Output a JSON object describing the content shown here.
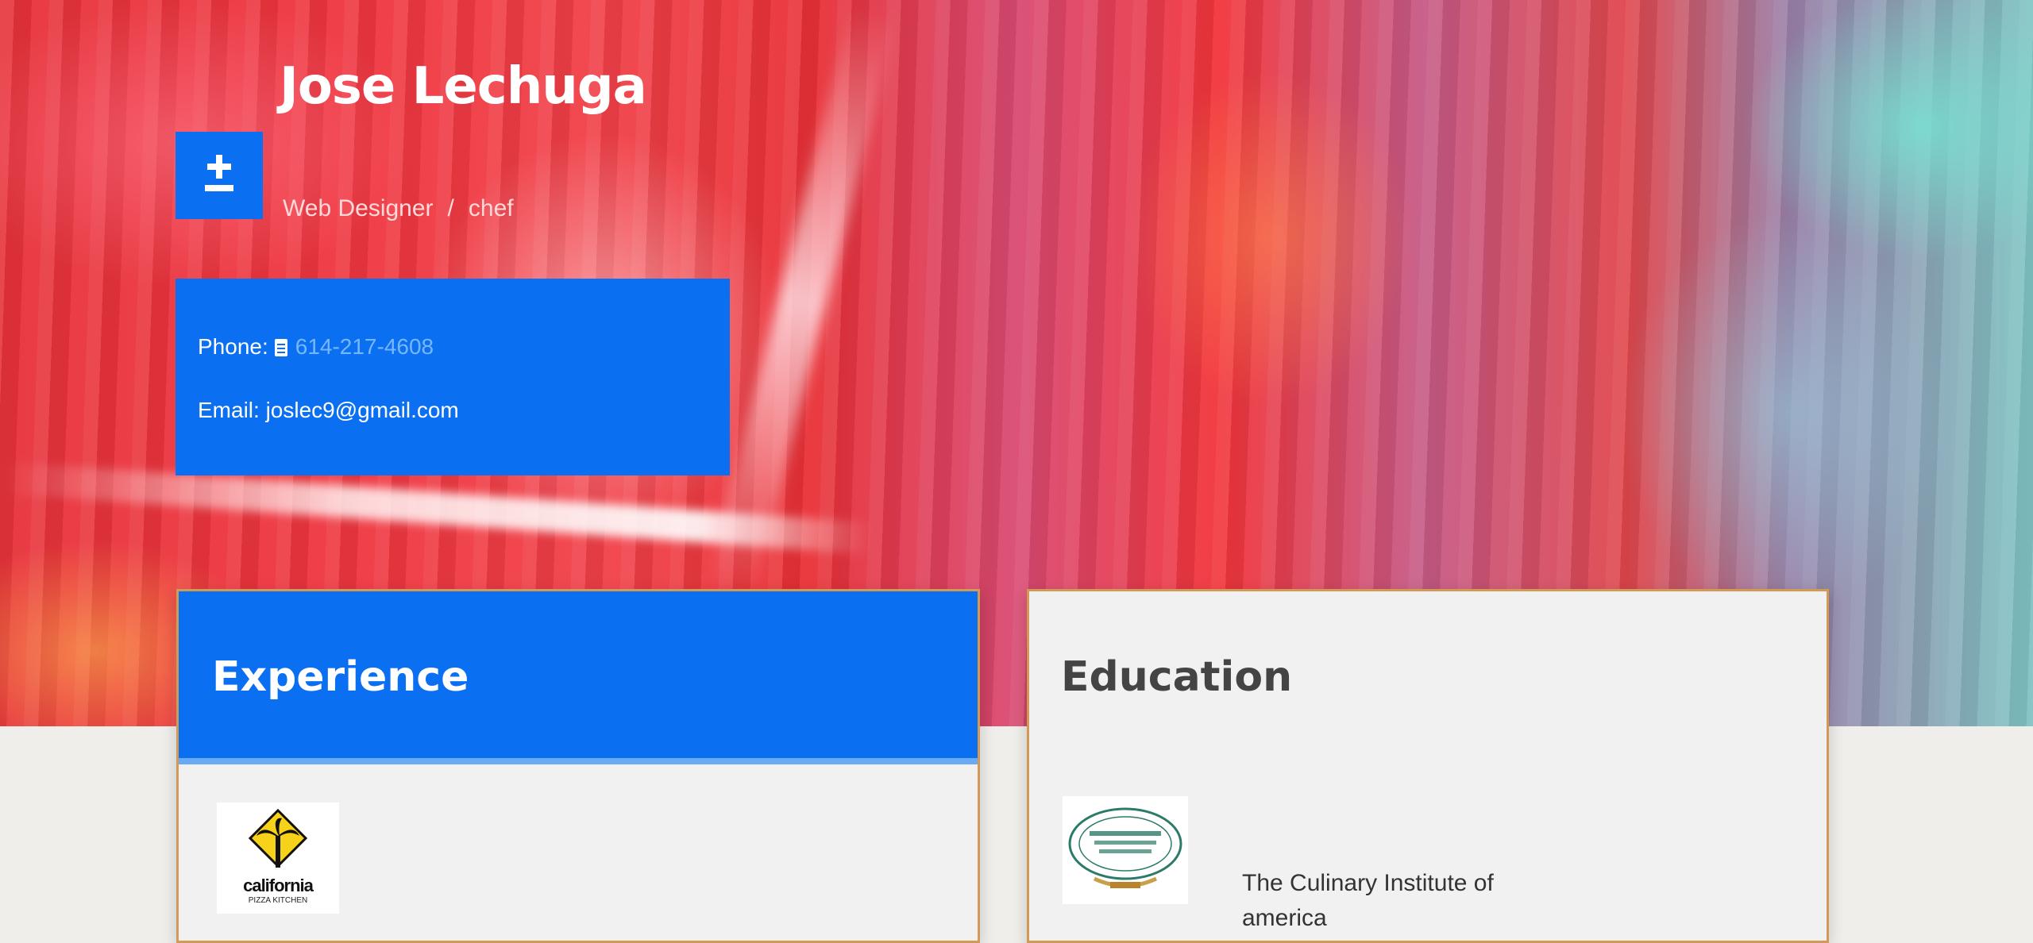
{
  "profile": {
    "name": "Jose Lechuga",
    "role_primary": "Web Designer",
    "role_separator": "/",
    "role_secondary": "chef"
  },
  "contact": {
    "phone_label": "Phone:",
    "phone_value": "614-217-4608",
    "email_label": "Email:",
    "email_value": "joslec9@gmail.com"
  },
  "sections": {
    "experience_title": "Experience",
    "education_title": "Education"
  },
  "experience": {
    "logo_text": "california",
    "logo_subtext": "PIZZA KITCHEN"
  },
  "education": {
    "school": "The Culinary Institute of america",
    "logo_text": "The Culinary Institute of America"
  },
  "colors": {
    "accent_blue": "#0b6ff2",
    "card_border": "#d49a55",
    "card_bg": "#f1f1f1"
  },
  "icons": {
    "toggle": "plus-minus-icon",
    "phone_doc": "document-icon"
  }
}
